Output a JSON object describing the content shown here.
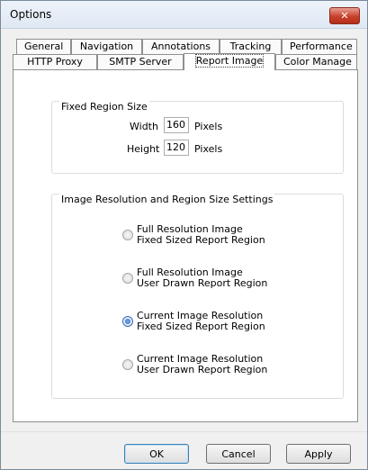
{
  "window": {
    "title": "Options",
    "close_label": "✕"
  },
  "tabs_row1": [
    {
      "label": "General"
    },
    {
      "label": "Navigation"
    },
    {
      "label": "Annotations"
    },
    {
      "label": "Tracking"
    },
    {
      "label": "Performance"
    }
  ],
  "tabs_row2": [
    {
      "label": "HTTP Proxy"
    },
    {
      "label": "SMTP Server"
    },
    {
      "label": "Report Image",
      "selected": true
    },
    {
      "label": "Color Manage"
    }
  ],
  "fixed_region": {
    "title": "Fixed Region Size",
    "width_label": "Width",
    "width_value": "160",
    "width_unit": "Pixels",
    "height_label": "Height",
    "height_value": "120",
    "height_unit": "Pixels"
  },
  "resolution": {
    "title": "Image Resolution and Region Size Settings",
    "options": [
      {
        "line1": "Full Resolution Image",
        "line2": "Fixed Sized Report Region",
        "checked": false
      },
      {
        "line1": "Full Resolution Image",
        "line2": "User Drawn Report Region",
        "checked": false
      },
      {
        "line1": "Current Image Resolution",
        "line2": "Fixed Sized Report Region",
        "checked": true
      },
      {
        "line1": "Current Image Resolution",
        "line2": "User Drawn Report Region",
        "checked": false
      }
    ]
  },
  "buttons": {
    "ok": "OK",
    "cancel": "Cancel",
    "apply": "Apply"
  }
}
